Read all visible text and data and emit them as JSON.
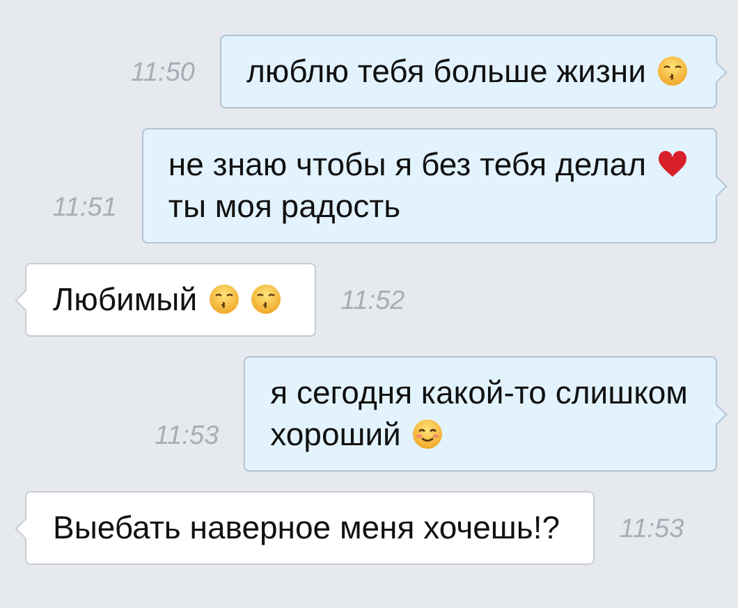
{
  "messages": [
    {
      "kind": "outgoing",
      "time": "11:50",
      "lines": [
        {
          "parts": [
            {
              "kind": "text",
              "text": "люблю тебя больше жизни"
            },
            {
              "kind": "kiss"
            }
          ]
        }
      ]
    },
    {
      "kind": "outgoing",
      "time": "11:51",
      "lines": [
        {
          "parts": [
            {
              "kind": "text",
              "text": "не знаю чтобы я без тебя делал"
            },
            {
              "kind": "heart"
            }
          ]
        },
        {
          "parts": [
            {
              "kind": "text",
              "text": "ты моя радость"
            }
          ]
        }
      ]
    },
    {
      "kind": "incoming",
      "time": "11:52",
      "lines": [
        {
          "parts": [
            {
              "kind": "text",
              "text": "Любимый"
            },
            {
              "kind": "kiss"
            },
            {
              "kind": "kiss"
            }
          ]
        }
      ]
    },
    {
      "kind": "outgoing",
      "time": "11:53",
      "lines": [
        {
          "parts": [
            {
              "kind": "text",
              "text": "я сегодня какой-то слишком"
            }
          ]
        },
        {
          "parts": [
            {
              "kind": "text",
              "text": "хороший"
            },
            {
              "kind": "smile"
            }
          ]
        }
      ]
    },
    {
      "kind": "incoming",
      "time": "11:53",
      "lines": [
        {
          "parts": [
            {
              "kind": "text",
              "text": "Выебать наверное меня хочешь!?"
            }
          ]
        }
      ]
    }
  ]
}
